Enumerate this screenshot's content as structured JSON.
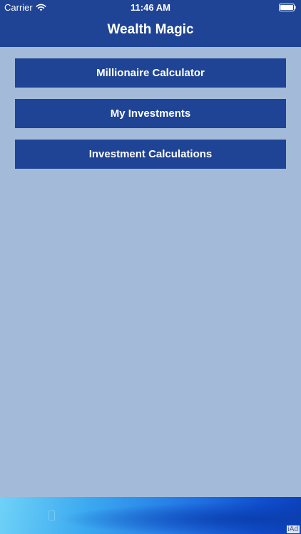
{
  "status_bar": {
    "carrier": "Carrier",
    "time": "11:46 AM",
    "wifi_icon": "wifi-icon",
    "battery_icon": "battery-full-icon"
  },
  "nav": {
    "title": "Wealth Magic"
  },
  "menu": {
    "items": [
      {
        "label": "Millionaire Calculator"
      },
      {
        "label": "My Investments"
      },
      {
        "label": "Investment Calculations"
      }
    ]
  },
  "ad": {
    "label": "iAd"
  },
  "colors": {
    "nav_background": "#1f4495",
    "button_background": "#1f4495",
    "page_background": "#a3bbd9",
    "text_light": "#ffffff"
  }
}
